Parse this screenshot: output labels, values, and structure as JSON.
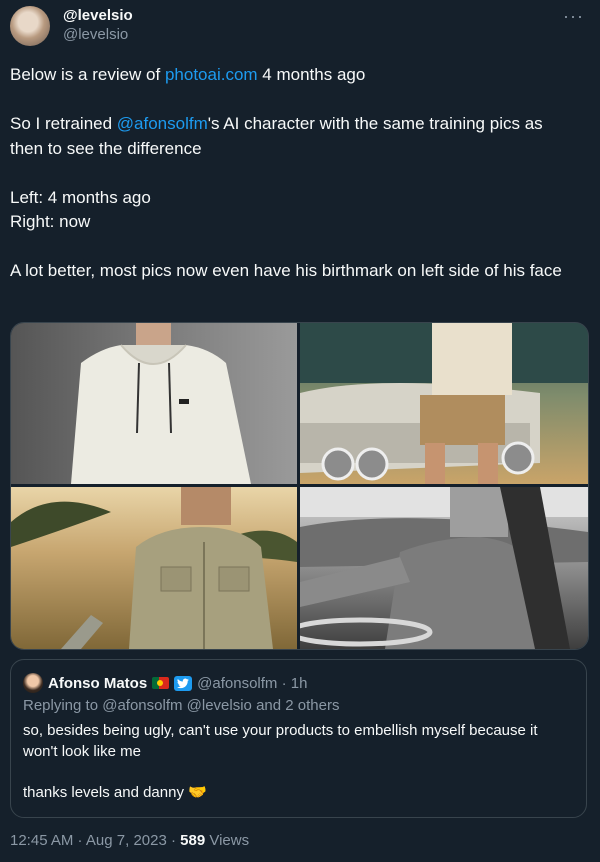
{
  "author": {
    "display_name": "@levelsio",
    "handle": "@levelsio",
    "more_label": "···"
  },
  "tweet": {
    "line1_prefix": "Below is a review of ",
    "line1_link": "photoai.com",
    "line1_suffix": " 4 months ago",
    "line2_prefix": "So I retrained ",
    "line2_mention": "@afonsolfm",
    "line2_suffix": "'s AI character with the same training pics as then to see the difference",
    "line3a": "Left: 4 months ago",
    "line3b": "Right: now",
    "line4": "A lot better, most pics now even have his birthmark on left side of his face"
  },
  "media": {
    "images": [
      {
        "name": "photo-cream-hoodie"
      },
      {
        "name": "photo-car-shorts"
      },
      {
        "name": "photo-safari-shirt"
      },
      {
        "name": "photo-bw-driving"
      }
    ]
  },
  "quote": {
    "name": "Afonso Matos",
    "handle": "@afonsolfm",
    "separator": " · ",
    "time": "1h",
    "reply_prefix": "Replying to ",
    "reply_mentions": "@afonsolfm @levelsio and 2 others",
    "text1": "so, besides being ugly, can't use your products to embellish myself because it won't look like me",
    "text2": "thanks levels and danny 🤝"
  },
  "meta": {
    "time": "12:45 AM",
    "date": "Aug 7, 2023",
    "separator": " · ",
    "views_count": "589",
    "views_label": " Views"
  }
}
